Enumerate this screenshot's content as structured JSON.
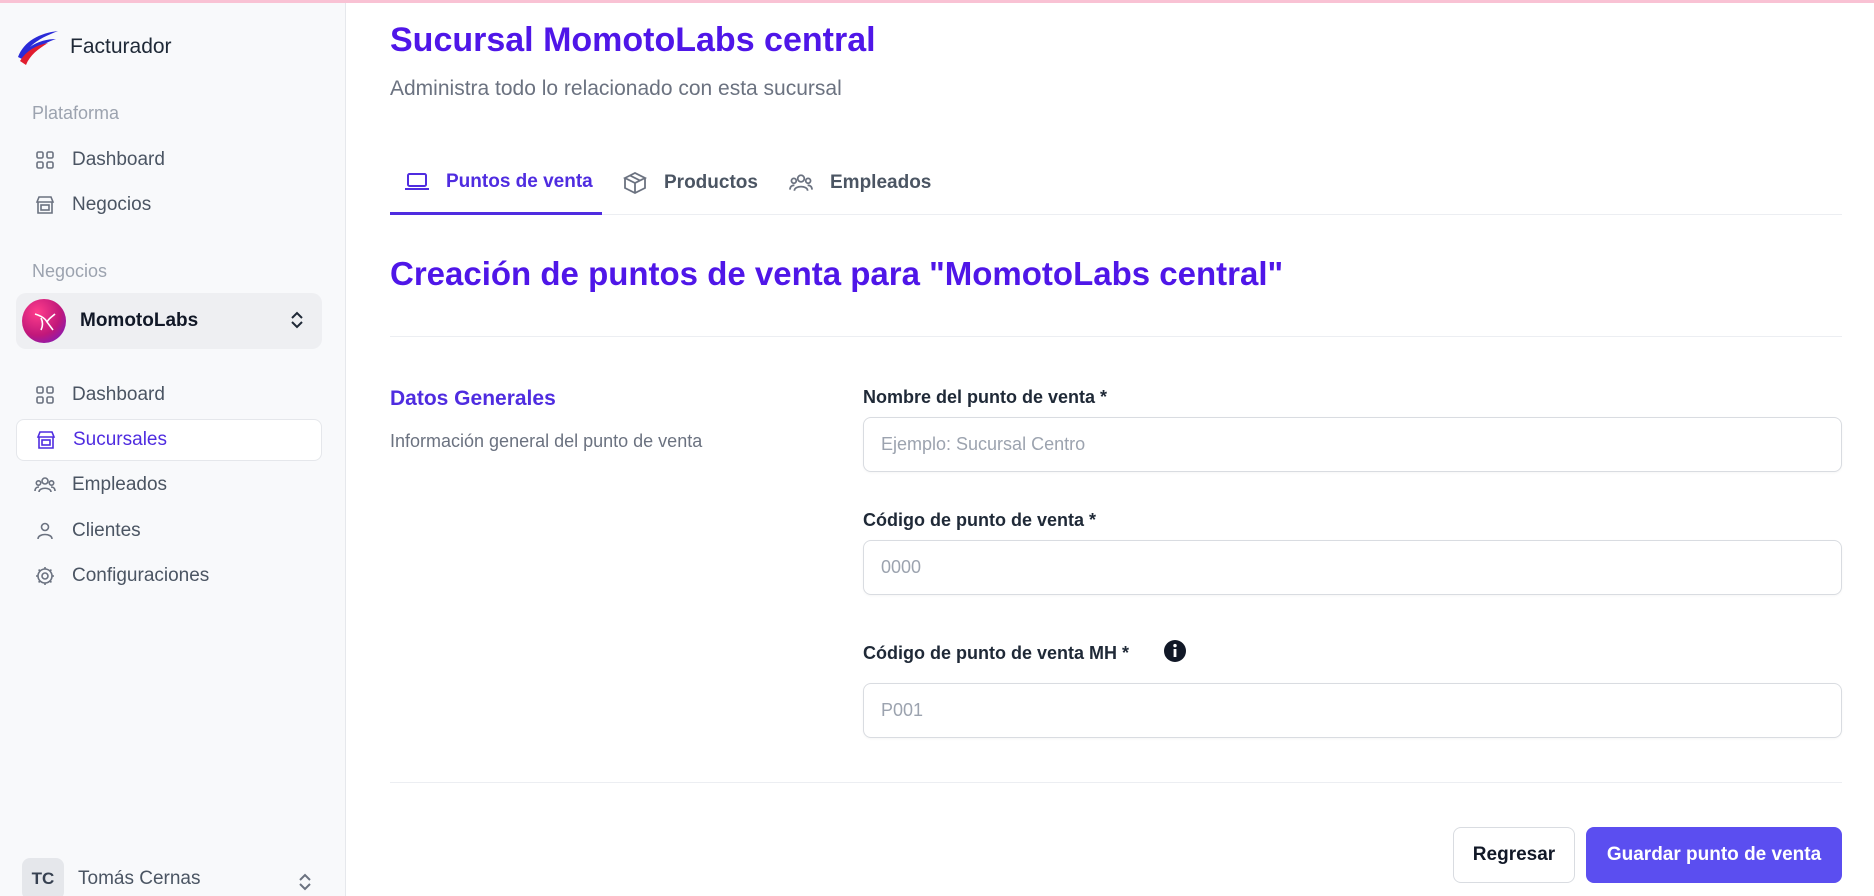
{
  "app": {
    "name": "Facturador"
  },
  "sidebar": {
    "platform_title": "Plataforma",
    "platform_items": [
      {
        "label": "Dashboard",
        "icon": "grid-icon"
      },
      {
        "label": "Negocios",
        "icon": "store-icon"
      }
    ],
    "business_title": "Negocios",
    "business_selector": {
      "name": "MomotoLabs"
    },
    "business_items": [
      {
        "label": "Dashboard",
        "icon": "grid-icon",
        "active": false
      },
      {
        "label": "Sucursales",
        "icon": "store-icon",
        "active": true
      },
      {
        "label": "Empleados",
        "icon": "users-icon",
        "active": false
      },
      {
        "label": "Clientes",
        "icon": "user-icon",
        "active": false
      },
      {
        "label": "Configuraciones",
        "icon": "gear-icon",
        "active": false
      }
    ],
    "user": {
      "initials": "TC",
      "name": "Tomás Cernas"
    }
  },
  "header": {
    "title": "Sucursal MomotoLabs central",
    "subtitle": "Administra todo lo relacionado con esta sucursal"
  },
  "tabs": [
    {
      "label": "Puntos de venta",
      "icon": "laptop-icon",
      "active": true
    },
    {
      "label": "Productos",
      "icon": "box-icon",
      "active": false
    },
    {
      "label": "Empleados",
      "icon": "users-icon",
      "active": false
    }
  ],
  "form": {
    "title": "Creación de puntos de venta para \"MomotoLabs central\"",
    "section_title": "Datos Generales",
    "section_description": "Información general del punto de venta",
    "fields": {
      "name": {
        "label": "Nombre del punto de venta *",
        "placeholder": "Ejemplo: Sucursal Centro",
        "value": ""
      },
      "code": {
        "label": "Código de punto de venta *",
        "placeholder": "0000",
        "value": ""
      },
      "mh_code": {
        "label": "Código de punto de venta MH *",
        "placeholder": "P001",
        "value": ""
      }
    },
    "buttons": {
      "back": "Regresar",
      "save": "Guardar punto de venta"
    }
  },
  "colors": {
    "accent": "#4f16e8",
    "primary_button": "#5b4ef0",
    "sidebar_bg": "#f8f9fb"
  }
}
